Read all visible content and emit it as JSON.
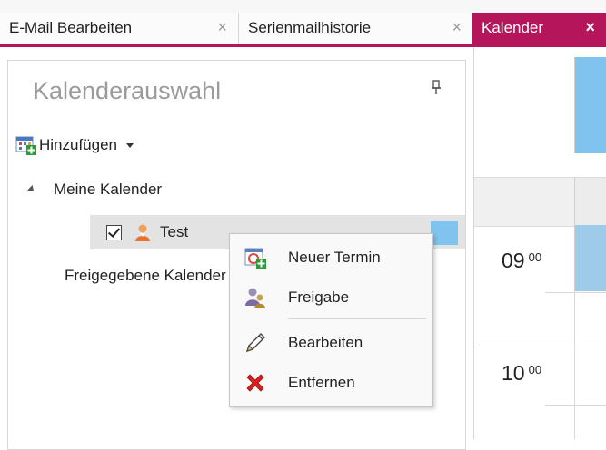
{
  "tabs": [
    {
      "label": "E-Mail Bearbeiten",
      "close": "×",
      "active": false
    },
    {
      "label": "Serienmailhistorie",
      "close": "×",
      "active": false
    },
    {
      "label": "Kalender",
      "close": "×",
      "active": true
    }
  ],
  "panel": {
    "title": "Kalenderauswahl",
    "add_label": "Hinzufügen",
    "group_label": "Meine Kalender",
    "calendar_item": {
      "label": "Test",
      "checked": true,
      "color": "#80c3ee"
    },
    "shared_label": "Freigegebene Kalender"
  },
  "context_menu": {
    "items": [
      {
        "label": "Neuer Termin",
        "icon": "new-appointment-icon"
      },
      {
        "label": "Freigabe",
        "icon": "share-icon"
      },
      {
        "label": "Bearbeiten",
        "icon": "pencil-icon"
      },
      {
        "label": "Entfernen",
        "icon": "delete-icon"
      }
    ]
  },
  "calendar": {
    "hours": [
      {
        "hour": "09",
        "minutes": "00"
      },
      {
        "hour": "10",
        "minutes": "00"
      }
    ]
  },
  "colors": {
    "accent": "#b5165b",
    "calendar_blue": "#80c3ee"
  }
}
